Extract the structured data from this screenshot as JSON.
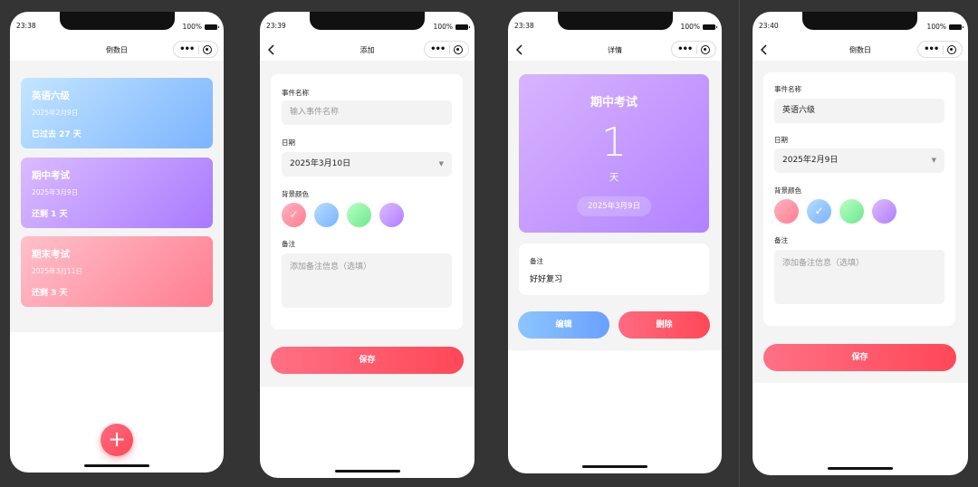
{
  "colors": {
    "accent": "#ff4757",
    "card_blue": "#78b3ff",
    "card_purple": "#b07dff",
    "card_pink": "#ff7d90"
  },
  "phone1": {
    "time": "23:38",
    "battery": "100%",
    "title": "倒数日",
    "events": [
      {
        "name": "英语六级",
        "date": "2025年2月9日",
        "count": "已过去 27 天"
      },
      {
        "name": "期中考试",
        "date": "2025年3月9日",
        "count": "还剩 1 天"
      },
      {
        "name": "期末考试",
        "date": "2025年3月11日",
        "count": "还剩 3 天"
      }
    ],
    "fab_icon": "+"
  },
  "phone2": {
    "time": "23:39",
    "battery": "100%",
    "title": "添加",
    "name_label": "事件名称",
    "name_placeholder": "输入事件名称",
    "date_label": "日期",
    "date_value": "2025年3月10日",
    "color_label": "背景颜色",
    "check": "✓",
    "note_label": "备注",
    "note_placeholder": "添加备注信息（选填）",
    "save": "保存"
  },
  "phone3": {
    "time": "23:38",
    "battery": "100%",
    "title": "详情",
    "name": "期中考试",
    "number": "1",
    "unit": "天",
    "date": "2025年3月9日",
    "note_label": "备注",
    "note_value": "好好复习",
    "edit": "编辑",
    "delete": "删除"
  },
  "phone4": {
    "time": "23:40",
    "battery": "100%",
    "title": "倒数日",
    "name_label": "事件名称",
    "name_value": "英语六级",
    "date_label": "日期",
    "date_value": "2025年2月9日",
    "color_label": "背景颜色",
    "check": "✓",
    "note_label": "备注",
    "note_placeholder": "添加备注信息（选填）",
    "save": "保存"
  },
  "icons": {
    "more": "•••",
    "caret": "▼"
  }
}
